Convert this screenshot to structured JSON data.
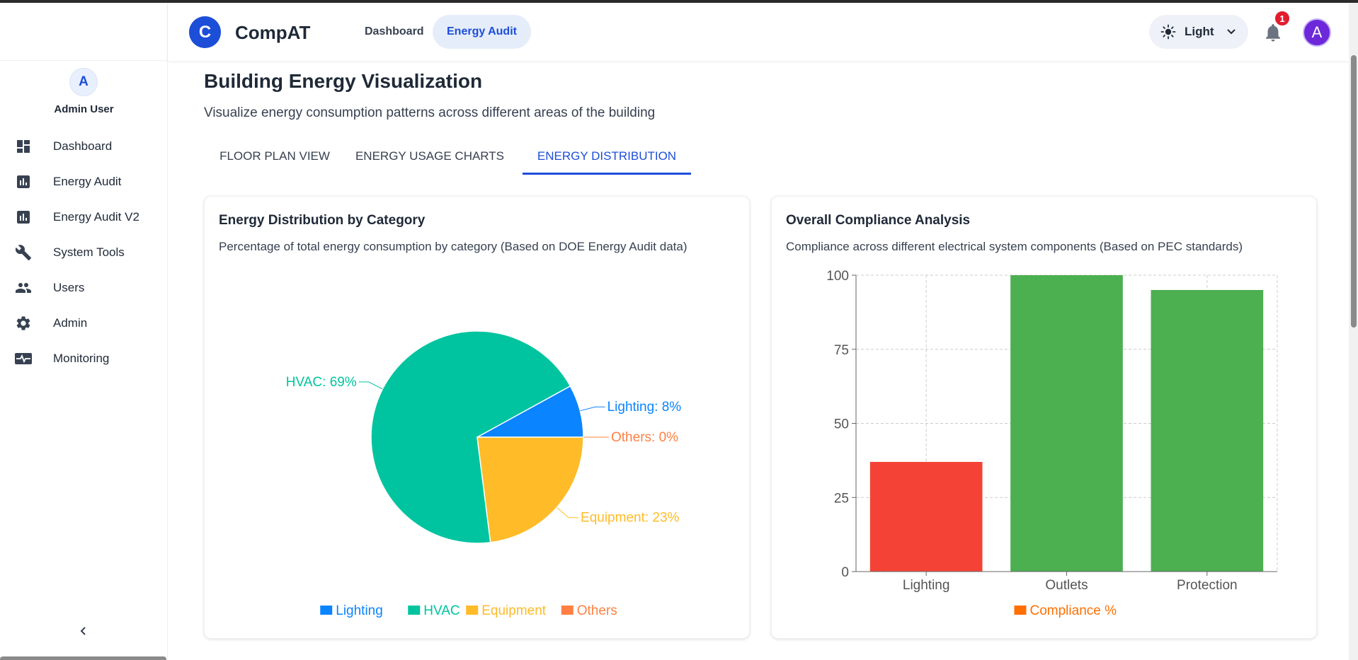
{
  "app": {
    "brand_initial": "C",
    "brand_name": "CompAT",
    "top_tabs": [
      "Dashboard",
      "Energy Audit"
    ],
    "theme_label": "Light",
    "notification_count": "1",
    "user_initial": "A"
  },
  "sidebar": {
    "avatar_initial": "A",
    "user_name": "Admin User",
    "items": [
      {
        "label": "Dashboard",
        "icon": "dashboard-icon"
      },
      {
        "label": "Energy Audit",
        "icon": "bar-chart-icon"
      },
      {
        "label": "Energy Audit V2",
        "icon": "bar-chart-icon"
      },
      {
        "label": "System Tools",
        "icon": "wrench-icon"
      },
      {
        "label": "Users",
        "icon": "users-icon"
      },
      {
        "label": "Admin",
        "icon": "gear-icon"
      },
      {
        "label": "Monitoring",
        "icon": "monitor-heart-icon"
      }
    ]
  },
  "page": {
    "title": "Building Energy Visualization",
    "subtitle": "Visualize energy consumption patterns across different areas of the building",
    "tabs": [
      "FLOOR PLAN VIEW",
      "ENERGY USAGE CHARTS",
      "ENERGY DISTRIBUTION"
    ],
    "active_tab": "ENERGY DISTRIBUTION"
  },
  "colors": {
    "accent": "#1d4ed8",
    "lighting": "#0a84ff",
    "hvac": "#00c49f",
    "equipment": "#ffbb28",
    "others": "#ff8042",
    "compliance_red": "#f44336",
    "compliance_green": "#4caf50",
    "compliance_legend": "#ff6f00"
  },
  "chart_data": [
    {
      "type": "pie",
      "title": "Energy Distribution by Category",
      "subtitle": "Percentage of total energy consumption by category (Based on DOE Energy Audit data)",
      "slices": [
        {
          "name": "Lighting",
          "value": 8,
          "label": "Lighting: 8%",
          "color": "#0a84ff"
        },
        {
          "name": "HVAC",
          "value": 69,
          "label": "HVAC: 69%",
          "color": "#00c49f"
        },
        {
          "name": "Equipment",
          "value": 23,
          "label": "Equipment: 23%",
          "color": "#ffbb28"
        },
        {
          "name": "Others",
          "value": 0,
          "label": "Others: 0%",
          "color": "#ff8042"
        }
      ],
      "legend": [
        "Lighting",
        "HVAC",
        "Equipment",
        "Others"
      ],
      "legend_position": "bottom"
    },
    {
      "type": "bar",
      "title": "Overall Compliance Analysis",
      "subtitle": "Compliance across different electrical system components (Based on PEC standards)",
      "categories": [
        "Lighting",
        "Outlets",
        "Protection"
      ],
      "values": [
        37,
        100,
        95
      ],
      "bar_colors": [
        "#f44336",
        "#4caf50",
        "#4caf50"
      ],
      "ylim": [
        0,
        100
      ],
      "yticks": [
        0,
        25,
        50,
        75,
        100
      ],
      "grid": true,
      "legend": [
        "Compliance %"
      ],
      "legend_position": "bottom"
    }
  ]
}
